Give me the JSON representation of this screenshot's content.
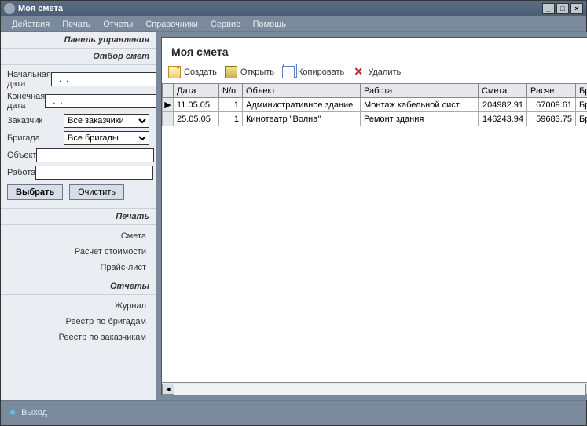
{
  "window": {
    "title": "Моя смета"
  },
  "menu": [
    "Действия",
    "Печать",
    "Отчеты",
    "Справочники",
    "Сервис",
    "Помощь"
  ],
  "sidebar": {
    "panel_header": "Панель управления",
    "filter_header": "Отбор смет",
    "filters": {
      "start_date_label": "Начальная дата",
      "start_date_value": "  .  .",
      "end_date_label": "Конечная дата",
      "end_date_value": "  .  .",
      "customer_label": "Заказчик",
      "customer_value": "Все заказчики",
      "brigade_label": "Бригада",
      "brigade_value": "Все бригады",
      "object_label": "Объект",
      "object_value": "",
      "work_label": "Работа",
      "work_value": "",
      "select_btn": "Выбрать",
      "clear_btn": "Очистить"
    },
    "print_header": "Печать",
    "print_links": [
      "Смета",
      "Расчет стоимости",
      "Прайс-лист"
    ],
    "reports_header": "Отчеты",
    "reports_links": [
      "Журнал",
      "Реестр по бригадам",
      "Реестр по заказчикам"
    ]
  },
  "main": {
    "title": "Моя смета",
    "toolbar": {
      "create": "Создать",
      "open": "Открыть",
      "copy": "Копировать",
      "delete": "Удалить"
    },
    "columns": [
      "Дата",
      "N/n",
      "Объект",
      "Работа",
      "Смета",
      "Расчет",
      "Бри"
    ],
    "rows": [
      {
        "date": "11.05.05",
        "nn": "1",
        "object": "Административное здание",
        "work": "Монтаж кабельной сист",
        "smeta": "204982.91",
        "raschet": "67009.61",
        "brig": "Бри"
      },
      {
        "date": "25.05.05",
        "nn": "1",
        "object": "Кинотеатр \"Волна\"",
        "work": "Ремонт здания",
        "smeta": "146243.94",
        "raschet": "59683.75",
        "brig": "Бри"
      }
    ]
  },
  "footer": {
    "exit": "Выход"
  }
}
